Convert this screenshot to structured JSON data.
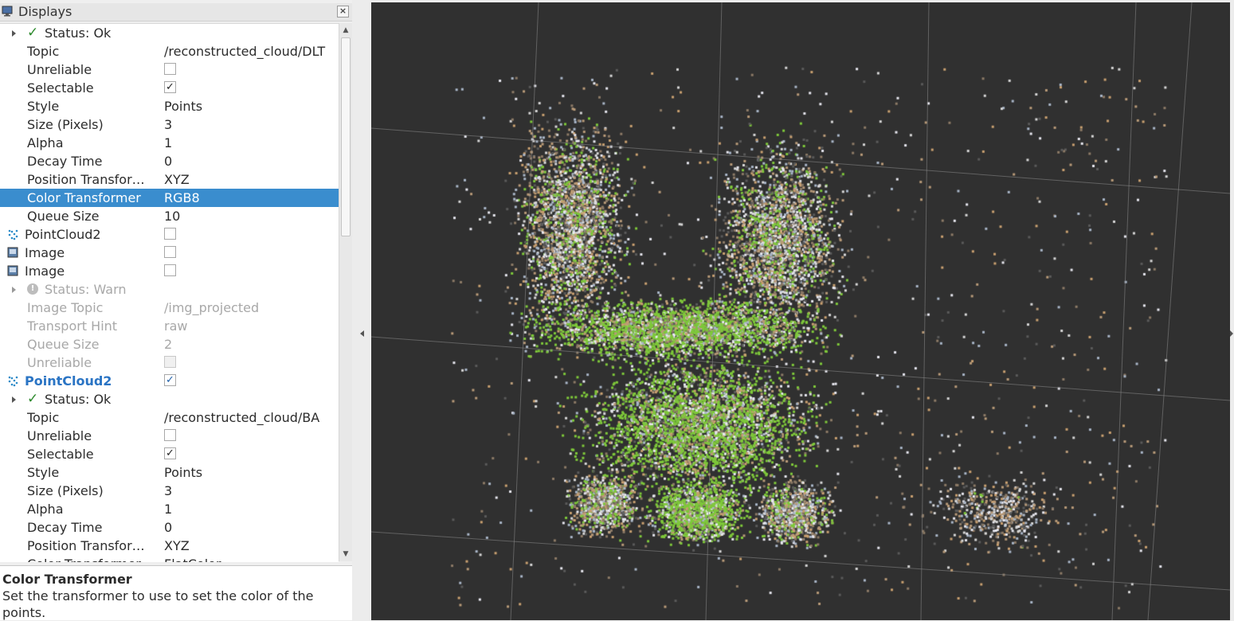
{
  "panel": {
    "title": "Displays",
    "close_label": "×",
    "rows": [
      {
        "kind": "status",
        "text": "Status: Ok",
        "state": "ok"
      },
      {
        "kind": "prop",
        "name": "Topic",
        "value": "/reconstructed_cloud/DLT"
      },
      {
        "kind": "prop-check",
        "name": "Unreliable",
        "checked": false
      },
      {
        "kind": "prop-check",
        "name": "Selectable",
        "checked": true
      },
      {
        "kind": "prop",
        "name": "Style",
        "value": "Points"
      },
      {
        "kind": "prop",
        "name": "Size (Pixels)",
        "value": "3"
      },
      {
        "kind": "prop",
        "name": "Alpha",
        "value": "1"
      },
      {
        "kind": "prop",
        "name": "Decay Time",
        "value": "0"
      },
      {
        "kind": "prop",
        "name": "Position Transfor…",
        "value": "XYZ"
      },
      {
        "kind": "prop",
        "name": "Color Transformer",
        "value": "RGB8",
        "selected": true
      },
      {
        "kind": "prop",
        "name": "Queue Size",
        "value": "10"
      },
      {
        "kind": "display",
        "icon": "pointcloud-icon",
        "name": "PointCloud2",
        "checked": false
      },
      {
        "kind": "display",
        "icon": "image-icon",
        "name": "Image",
        "checked": false
      },
      {
        "kind": "display",
        "icon": "image-icon",
        "name": "Image",
        "checked": false
      },
      {
        "kind": "status",
        "text": "Status: Warn",
        "state": "warn",
        "disabled": true
      },
      {
        "kind": "prop",
        "name": "Image Topic",
        "value": "/img_projected",
        "disabled": true
      },
      {
        "kind": "prop",
        "name": "Transport Hint",
        "value": "raw",
        "disabled": true
      },
      {
        "kind": "prop",
        "name": "Queue Size",
        "value": "2",
        "disabled": true
      },
      {
        "kind": "prop-check",
        "name": "Unreliable",
        "checked": false,
        "disabled": true
      },
      {
        "kind": "display",
        "icon": "pointcloud-icon",
        "name": "PointCloud2",
        "checked": true,
        "active": true
      },
      {
        "kind": "status",
        "text": "Status: Ok",
        "state": "ok"
      },
      {
        "kind": "prop",
        "name": "Topic",
        "value": "/reconstructed_cloud/BA"
      },
      {
        "kind": "prop-check",
        "name": "Unreliable",
        "checked": false
      },
      {
        "kind": "prop-check",
        "name": "Selectable",
        "checked": true
      },
      {
        "kind": "prop",
        "name": "Style",
        "value": "Points"
      },
      {
        "kind": "prop",
        "name": "Size (Pixels)",
        "value": "3"
      },
      {
        "kind": "prop",
        "name": "Alpha",
        "value": "1"
      },
      {
        "kind": "prop",
        "name": "Decay Time",
        "value": "0"
      },
      {
        "kind": "prop",
        "name": "Position Transfor…",
        "value": "XYZ"
      },
      {
        "kind": "prop",
        "name": "Color Transformer",
        "value": "FlatColor"
      }
    ]
  },
  "help": {
    "title": "Color Transformer",
    "text": "Set the transformer to use to set the color of the points."
  },
  "view": {
    "background": "#303030",
    "grid_color": "#8a8a8a",
    "point_colors": [
      "#7ec83a",
      "#d7d7d7",
      "#b89a78",
      "#8c7a66",
      "#e8e8f0",
      "#a9b6c8",
      "#c9a070",
      "#5a5a5a"
    ]
  }
}
